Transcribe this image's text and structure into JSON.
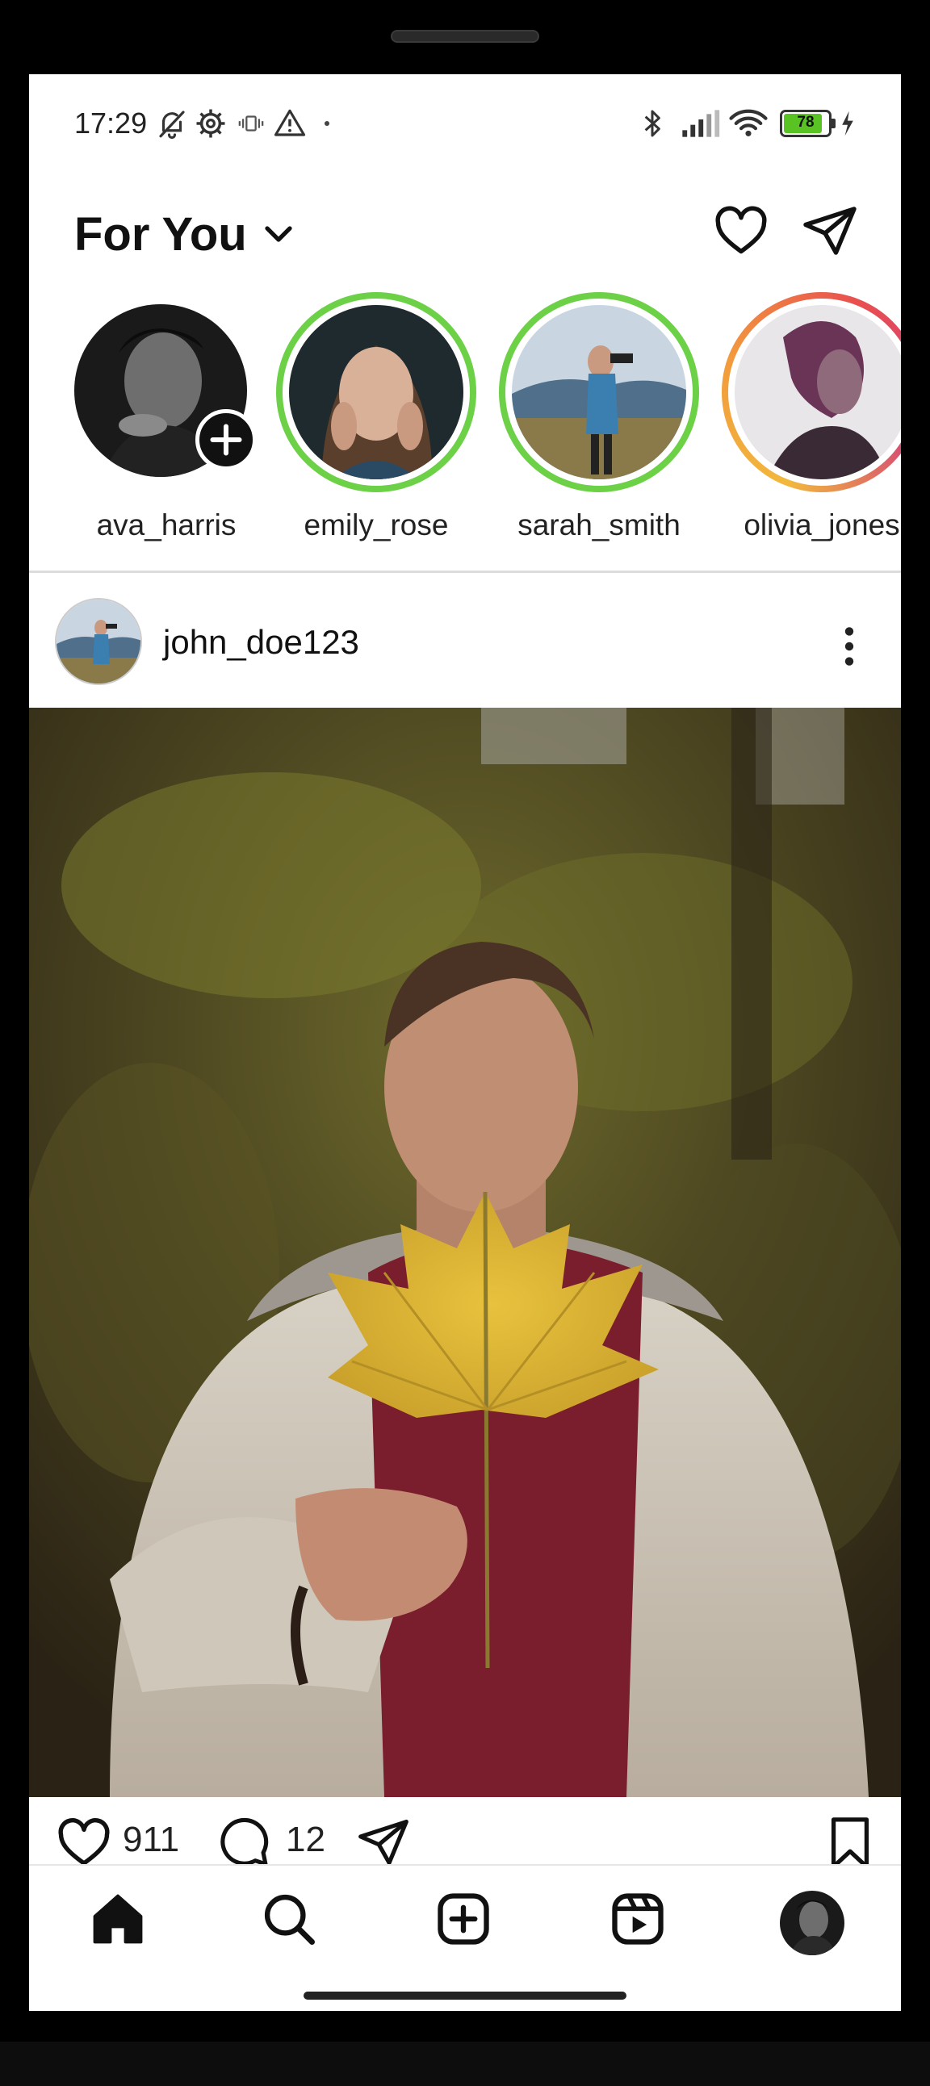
{
  "status_bar": {
    "time": "17:29",
    "battery": "78",
    "icons_left": [
      "bell-off-icon",
      "settings-gear-icon",
      "vibrate-icon",
      "alert-triangle-icon",
      "dot-icon"
    ],
    "icons_right": [
      "bluetooth-icon",
      "signal-icon",
      "wifi-icon",
      "battery-icon",
      "charging-bolt-icon"
    ]
  },
  "header": {
    "title": "For You",
    "icons": [
      "chevron-down-icon",
      "heart-icon",
      "send-icon"
    ]
  },
  "stories": [
    {
      "username": "ava_harris",
      "ring": "none",
      "is_own": true
    },
    {
      "username": "emily_rose",
      "ring": "green"
    },
    {
      "username": "sarah_smith",
      "ring": "green"
    },
    {
      "username": "olivia_jones",
      "ring": "gradient"
    }
  ],
  "post": {
    "username": "john_doe123",
    "likes": "911",
    "comments": "12"
  },
  "bottom_nav": {
    "items": [
      "home-icon",
      "search-icon",
      "add-post-icon",
      "reels-icon",
      "profile-avatar"
    ],
    "active": "home-icon"
  },
  "colors": {
    "story_ring_green": "#6cd146",
    "battery_fill": "#58c322",
    "text_primary": "#111111"
  }
}
